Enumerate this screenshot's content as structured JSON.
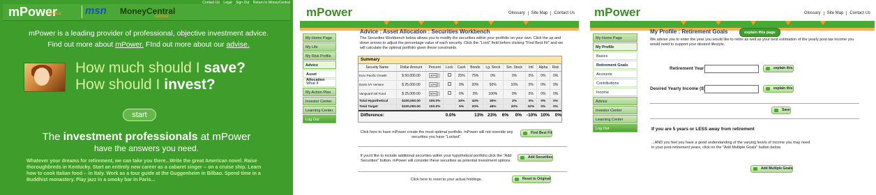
{
  "panel1": {
    "toplinks": [
      "Contact Us",
      "Legal",
      "Sign Out",
      "Return to MoneyCentral"
    ],
    "logo": "mPower",
    "logo_sub": "Advisor",
    "msn": "msn",
    "moneycentral": "MoneyCentral",
    "moneycentral_sub": "Advisor",
    "intro_line1": "mPower is a leading provider of professional, objective investment advice.",
    "intro_line2_prefix": "Find out more about ",
    "intro_link1": "mPower.",
    "intro_line2_mid": " FInd out more about our ",
    "intro_link2": "advise.",
    "question1_prefix": "How much should I ",
    "question1_bold": "save?",
    "question2_prefix": "How should I ",
    "question2_bold": "invest?",
    "start_label": "start",
    "tagline1_prefix": "The ",
    "tagline1_bold": "investment professionals",
    "tagline1_suffix": " at mPower",
    "tagline2": "have the answers you need.",
    "promo_text": "Whatever your dreams for retirement, we can take you there...Write the great American novel. Raise thoroughbreds in Kentucky. Start an entirely new career as a cabaret singer -- on a cruise ship. Learn how to cook Italian food -- in Italy. Work as a tour guide at the Guggenheim in Bilbao. Spend time in a Buddhist monastery. Play jazz in a smoky bar in Paris..."
  },
  "panel2": {
    "logo": "mPower",
    "toplinks": [
      "Glossary",
      "Site Map",
      "Contact Us"
    ],
    "nav": [
      {
        "label": "My Home Page",
        "type": "main"
      },
      {
        "label": "My Life",
        "type": "main"
      },
      {
        "label": "My Risk Profile",
        "type": "main"
      },
      {
        "label": "Advice",
        "type": "active"
      },
      {
        "label": "Asset Allocation",
        "type": "sub-sel"
      },
      {
        "label": "What If",
        "type": "sub"
      },
      {
        "label": "My Action Plan",
        "type": "main"
      },
      {
        "label": "Investor Center",
        "type": "main"
      },
      {
        "label": "Learning Center",
        "type": "main"
      },
      {
        "label": "Log Out",
        "type": "logout"
      }
    ],
    "title": "Advice  :  Asset Allocation  :  Securities Workbench",
    "description": "The Securities Workbench below allows you to modify the securities within your portfolio on your own. Click the up and down arrows to adjust the percentage value of each security. Click the \"Lock\" field before clicking \"Find Best Fit\" and we will calculate the optimal portfolio given these constraints.",
    "summary_label": "Summary",
    "columns": [
      "Security Name",
      "Dollar Amount",
      "Percent",
      "Lock",
      "Cash",
      "Bonds",
      "Lg. Stock",
      "Sm. Stock",
      "Intl",
      "Alpha",
      "Risk"
    ],
    "rows": [
      {
        "name": "Euro Pacific Growth",
        "amount": "$ 50,000.00",
        "percent": "40%",
        "cash": "25%",
        "bonds": "75%",
        "lg": "0%",
        "sm": "0%",
        "intl": "0%",
        "alpha": "0%",
        "risk": "0%"
      },
      {
        "name": "Davis NY Venture",
        "amount": "$ 25,000.00",
        "percent": "10%",
        "cash": "0%",
        "bonds": "20%",
        "lg": "50%",
        "sm": "10%",
        "intl": "0%",
        "alpha": "0%",
        "risk": "0%"
      },
      {
        "name": "Vanguard Intl Fund",
        "amount": "$ 25,000.00",
        "percent": "50%",
        "cash": "0%",
        "bonds": "0%",
        "lg": "100%",
        "sm": "0%",
        "intl": "0%",
        "alpha": "0%",
        "risk": "0%"
      }
    ],
    "total_hypo": {
      "label": "Total Hypothetical",
      "amount": "$100,000.00",
      "percent": "100.0%",
      "cash": "10%",
      "bonds": "43%",
      "lg": "30%",
      "sm": "3%",
      "intl": "0%",
      "alpha": "0%",
      "risk": "0%"
    },
    "total_target": {
      "label": "Total Target",
      "amount": "$100,000.00",
      "percent": "100.0%",
      "cash": "5%",
      "bonds": "20%",
      "lg": "45%",
      "sm": "20%",
      "intl": "10%",
      "alpha": "0%",
      "risk": "0%"
    },
    "difference": {
      "label": "Difference:",
      "percent": "0.0%",
      "cash": "13%",
      "bonds": "23%",
      "lg": "6%",
      "sm": "0%",
      "intl": "-10%",
      "alpha": "10%",
      "risk": "0%"
    },
    "note1": "Click here to have mPower create the most optimal portfolio. mPower will not override any securities you have \"Locked\".",
    "btn_best_fit": "Find Best Fit",
    "note2": "If you'd like to include additional securities within your hypothetical portfolio,click the \"Add Securities\" button. mPower will consider these securities as potential investment options.",
    "btn_add_securities": "Add Securities",
    "note3": "Click here to reset to your actual holdings.",
    "btn_reset": "Reset to Original"
  },
  "panel3": {
    "logo": "mPower",
    "toplinks": [
      "Glossary",
      "Site Map",
      "Contact Us"
    ],
    "nav": [
      {
        "label": "My Home Page",
        "type": "main"
      },
      {
        "label": "My Profile",
        "type": "active"
      },
      {
        "label": "Basics",
        "type": "sub"
      },
      {
        "label": "Retirement Goals",
        "type": "sub-sel"
      },
      {
        "label": "Accounts",
        "type": "sub"
      },
      {
        "label": "Contributions",
        "type": "sub"
      },
      {
        "label": "Income",
        "type": "sub"
      },
      {
        "label": "Advice",
        "type": "main"
      },
      {
        "label": "Investor Center",
        "type": "main"
      },
      {
        "label": "Learning Center",
        "type": "main"
      },
      {
        "label": "Log Out",
        "type": "logout"
      }
    ],
    "title": "My Profile  :  Retirement Goals",
    "explain_page": "explain this page",
    "description": "We advise you to enter the year you would like to retire as well as your best estimation of the yearly post-tax income you would need to support your desired lifestyle.",
    "retirement_year_label": "Retirement Year:",
    "retirement_year_value": "",
    "income_label": "Desired Yearly Income ($):",
    "income_value": "",
    "explain_this": "explain this",
    "save": "Save",
    "section_title": "If you are 5 years or LESS away from retirement",
    "section_desc": "...AND you feel you have a good understanding of the varying levels of income you may need in your post-retirement years, click on the \"Add Multiple Goals\" button below.",
    "btn_multiple_goals": "Add Multiple Goals"
  }
}
